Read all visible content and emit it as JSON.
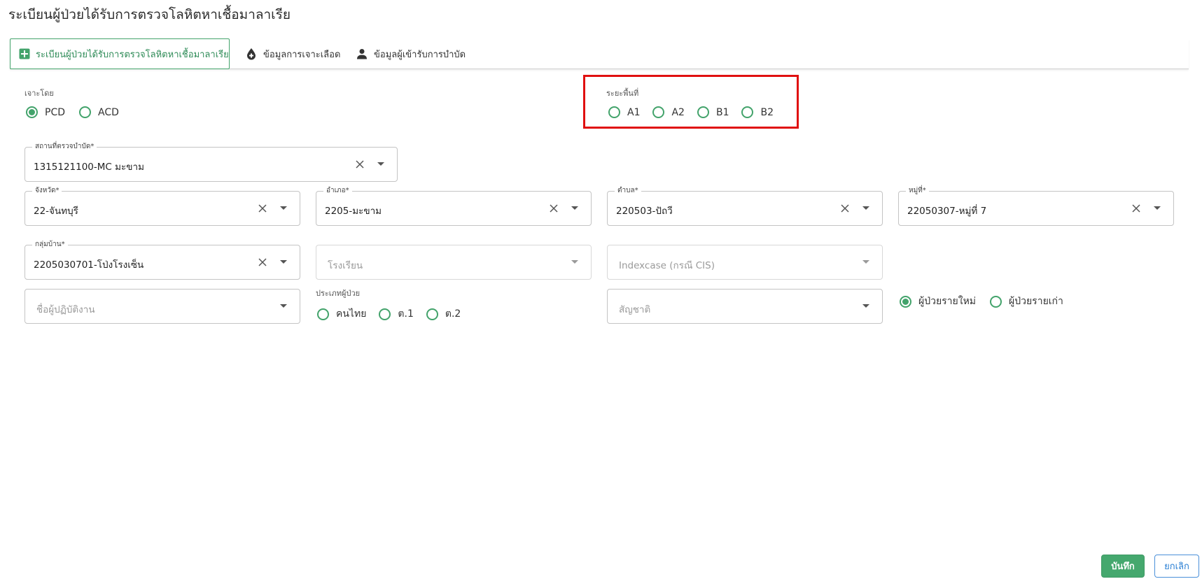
{
  "page": {
    "title": "ระเบียนผู้ป่วยได้รับการตรวจโลหิตหาเชื้อมาลาเรีย"
  },
  "tabs": [
    {
      "label": "ระเบียนผู้ป่วยได้รับการตรวจโลหิตหาเชื้อมาลาเรีย",
      "icon": "plus-square-icon",
      "active": true
    },
    {
      "label": "ข้อมูลการเจาะเลือด",
      "icon": "blood-drop-icon",
      "active": false
    },
    {
      "label": "ข้อมูลผู้เข้ารับการบำบัด",
      "icon": "person-icon",
      "active": false
    }
  ],
  "draw_by": {
    "label": "เจาะโดย",
    "options": [
      "PCD",
      "ACD"
    ],
    "selected": "PCD"
  },
  "area_level": {
    "label": "ระยะพื้นที่",
    "options": [
      "A1",
      "A2",
      "B1",
      "B2"
    ],
    "selected": null
  },
  "fields": {
    "treatment_site": {
      "label": "สถานที่ตรวจบำบัด*",
      "value": "1315121100-MC มะขาม"
    },
    "province": {
      "label": "จังหวัด*",
      "value": "22-จันทบุรี"
    },
    "district": {
      "label": "อำเภอ*",
      "value": "2205-มะขาม"
    },
    "subdistrict": {
      "label": "ตำบล*",
      "value": "220503-ปัถวี"
    },
    "village": {
      "label": "หมู่ที่*",
      "value": "22050307-หมู่ที่ 7"
    },
    "village_group": {
      "label": "กลุ่มบ้าน*",
      "value": "2205030701-โป่งโรงเซ็น"
    },
    "school": {
      "placeholder": "โรงเรียน"
    },
    "indexcase": {
      "placeholder": "Indexcase (กรณี CIS)"
    },
    "operator": {
      "placeholder": "ชื่อผู้ปฏิบัติงาน"
    },
    "nationality": {
      "placeholder": "สัญชาติ"
    }
  },
  "patient_type": {
    "label": "ประเภทผู้ป่วย",
    "options": [
      "คนไทย",
      "ต.1",
      "ต.2"
    ],
    "selected": null
  },
  "patient_status": {
    "options": [
      "ผู้ป่วยรายใหม่",
      "ผู้ป่วยรายเก่า"
    ],
    "selected": "ผู้ป่วยรายใหม่"
  },
  "actions": {
    "save": "บันทึก",
    "cancel": "ยกเลิก"
  },
  "colors": {
    "accent": "#43a36b",
    "highlight": "#e01010",
    "cancel_blue": "#2a7fd4"
  }
}
